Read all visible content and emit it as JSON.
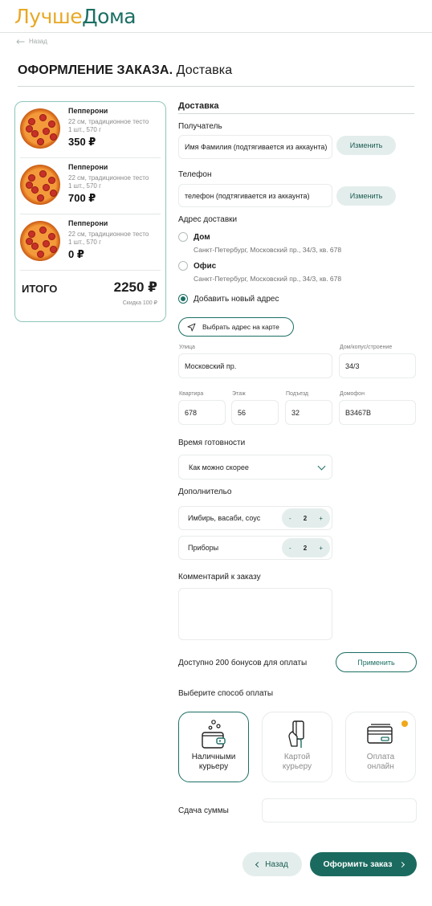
{
  "header": {
    "logo_part1": "Лучше",
    "logo_part2": "Дома",
    "back_link": "Назад",
    "page_title_bold": "ОФОРМЛЕНИЕ ЗАКАЗА.",
    "page_title_rest": " Доставка"
  },
  "cart": {
    "items": [
      {
        "name": "Пепперони",
        "desc_line1": "22 см, традиционное тесто",
        "desc_line2": "1 шт., 570 г",
        "price": "350 ₽"
      },
      {
        "name": "Пепперони",
        "desc_line1": "22 см, традиционное тесто",
        "desc_line2": "1 шт., 570 г",
        "price": "700 ₽"
      },
      {
        "name": "Пепперони",
        "desc_line1": "22 см, традиционное тесто",
        "desc_line2": "1 шт., 570 г",
        "price": "0 ₽"
      }
    ],
    "total_label": "ИТОГО",
    "total_value": "2250 ₽",
    "discount": "Скидка 100 ₽"
  },
  "form": {
    "section_title": "Доставка",
    "recipient_label": "Получатель",
    "recipient_value": "Имя Фамилия (подтягивается из аккаунта)",
    "change_label": "Изменить",
    "phone_label": "Телефон",
    "phone_value": "телефон (подтягивается из аккаунта)",
    "address_label": "Адрес доставки",
    "address_options": [
      {
        "title": "Дом",
        "address": "Санкт-Петербург, Московский пр., 34/3, кв. 678",
        "selected": false
      },
      {
        "title": "Офис",
        "address": "Санкт-Петербург, Московский пр., 34/3, кв. 678",
        "selected": false
      },
      {
        "title": "Добавить новый адрес",
        "address": "",
        "selected": true
      }
    ],
    "map_button": "Выбрать адрес на карте",
    "street_label": "Улица",
    "street_value": "Московский пр.",
    "house_label": "Дом/копус/строение",
    "house_value": "34/3",
    "apartment_label": "Квартира",
    "apartment_value": "678",
    "floor_label": "Этаж",
    "floor_value": "56",
    "entrance_label": "Подъезд",
    "entrance_value": "32",
    "intercom_label": "Домофон",
    "intercom_value": "В3467В",
    "ready_time_label": "Время готовности",
    "ready_time_value": "Как можно скорее",
    "extra_label": "Дополнительо",
    "extras": [
      {
        "name": "Имбирь, васаби, соус",
        "minus": "-",
        "qty": "2",
        "plus": "+"
      },
      {
        "name": "Приборы",
        "minus": "-",
        "qty": "2",
        "plus": "+"
      }
    ],
    "comment_label": "Комментарий к заказу",
    "bonus_text": "Доступно 200 бонусов для оплаты",
    "apply_label": "Применить",
    "payment_label": "Выберите способ оплаты",
    "payment_methods": [
      {
        "line1": "Наличными",
        "line2": "курьеру",
        "selected": true
      },
      {
        "line1": "Картой",
        "line2": "курьеру",
        "selected": false
      },
      {
        "line1": "Оплата",
        "line2": "онлайн",
        "selected": false
      }
    ],
    "change_sum_label": "Сдача суммы",
    "back_button": "Назад",
    "submit_button": "Оформить заказ"
  },
  "colors": {
    "brand_green": "#1c6f64",
    "brand_yellow": "#e8a826",
    "light_green_button": "#e3eeec",
    "badge_orange": "#f0a81b"
  },
  "icons": [
    "arrow-left-icon",
    "pizza-image",
    "navigation-arrow-icon",
    "chevron-down-icon",
    "cash-wallet-icon",
    "card-hand-icon",
    "card-online-icon",
    "chevron-right-icon"
  ]
}
